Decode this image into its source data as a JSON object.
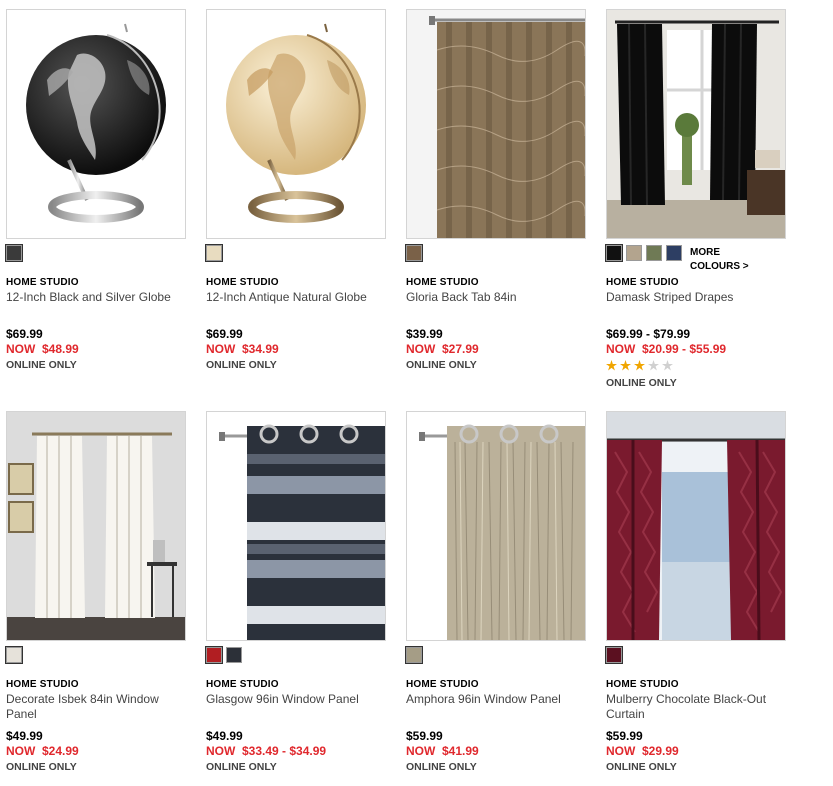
{
  "products": [
    {
      "brand": "HOME STUDIO",
      "name": "12-Inch Black and Silver Globe",
      "regular_price": "$69.99",
      "sale_price": "NOW  $48.99",
      "availability": "ONLINE ONLY",
      "swatches": [
        "#3a3a3a"
      ],
      "image": "globe-black"
    },
    {
      "brand": "HOME STUDIO",
      "name": "12-Inch Antique Natural Globe",
      "regular_price": "$69.99",
      "sale_price": "NOW  $34.99",
      "availability": "ONLINE ONLY",
      "swatches": [
        "#e8dcc0"
      ],
      "image": "globe-antique"
    },
    {
      "brand": "HOME STUDIO",
      "name": "Gloria Back Tab 84in",
      "regular_price": "$39.99",
      "sale_price": "NOW  $27.99",
      "availability": "ONLINE ONLY",
      "swatches": [
        "#7a6148"
      ],
      "image": "curtain-gloria"
    },
    {
      "brand": "HOME STUDIO",
      "name": "Damask Striped Drapes",
      "regular_price": "$69.99 - $79.99",
      "sale_price": "NOW  $20.99 - $55.99",
      "availability": "ONLINE ONLY",
      "swatches": [
        "#111111",
        "#b3a48e",
        "#6f7a55",
        "#2d3e63"
      ],
      "more_colours": "MORE\nCOLOURS >",
      "rating": 3,
      "rating_max": 5,
      "image": "drapes-black"
    },
    {
      "brand": "HOME STUDIO",
      "name": "Decorate Isbek 84in Window Panel",
      "regular_price": "$49.99",
      "sale_price": "NOW  $24.99",
      "availability": "ONLINE ONLY",
      "swatches": [
        "#e6e2da"
      ],
      "image": "curtain-white"
    },
    {
      "brand": "HOME STUDIO",
      "name": "Glasgow 96in Window Panel",
      "regular_price": "$49.99",
      "sale_price": "NOW  $33.49 - $34.99",
      "availability": "ONLINE ONLY",
      "swatches": [
        "#b11e22",
        "#2c3038"
      ],
      "image": "curtain-glasgow"
    },
    {
      "brand": "HOME STUDIO",
      "name": "Amphora 96in Window Panel",
      "regular_price": "$59.99",
      "sale_price": "NOW  $41.99",
      "availability": "ONLINE ONLY",
      "swatches": [
        "#a59d86"
      ],
      "image": "curtain-amphora"
    },
    {
      "brand": "HOME STUDIO",
      "name": "Mulberry Chocolate Black-Out Curtain",
      "regular_price": "$59.99",
      "sale_price": "NOW  $29.99",
      "availability": "ONLINE ONLY",
      "swatches": [
        "#5b1020"
      ],
      "image": "curtain-mulberry"
    }
  ],
  "colors": {
    "sale_red": "#e0282d",
    "star_filled": "#f0a500",
    "star_empty": "#d0d0d0"
  }
}
